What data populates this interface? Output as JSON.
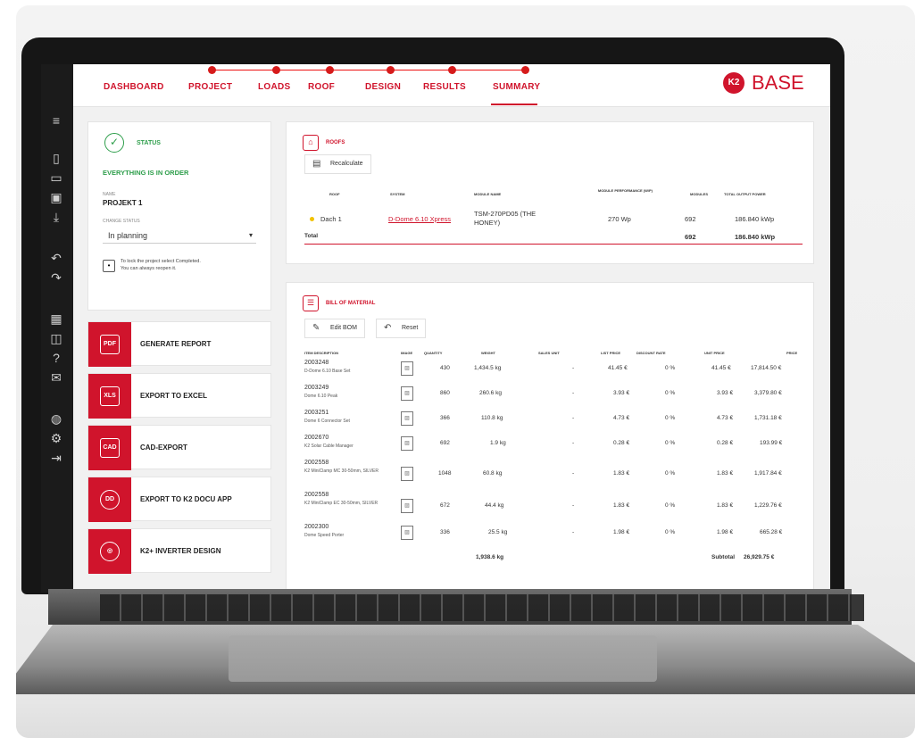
{
  "rail": {
    "icons": [
      "menu-icon",
      "new-project-icon",
      "folder-icon",
      "save-icon",
      "download-icon",
      "undo-icon",
      "redo-icon",
      "calculator-icon",
      "3d-view-icon",
      "help-icon",
      "chat-icon",
      "language-icon",
      "settings-icon",
      "logout-icon"
    ]
  },
  "nav": {
    "items": [
      "DASHBOARD",
      "PROJECT",
      "LOADS",
      "ROOF",
      "DESIGN",
      "RESULTS",
      "SUMMARY"
    ],
    "active": "SUMMARY",
    "logo_text": "BASE",
    "logo_mark": "K2"
  },
  "status": {
    "label": "STATUS",
    "message": "EVERYTHING IS IN ORDER",
    "name_label": "NAME",
    "project_name": "PROJEKT 1",
    "change_label": "CHANGE STATUS",
    "current_status": "In planning",
    "lock_hint_1": "To lock the project select Completed.",
    "lock_hint_2": "You can always reopen it."
  },
  "actions": [
    {
      "icon": "PDF",
      "label": "GENERATE REPORT"
    },
    {
      "icon": "XLS",
      "label": "EXPORT TO EXCEL"
    },
    {
      "icon": "CAD",
      "label": "CAD-EXPORT"
    },
    {
      "icon": "DD",
      "label": "EXPORT TO K2 DOCU APP"
    },
    {
      "icon": "◎",
      "label": "K2+ INVERTER DESIGN"
    }
  ],
  "roofs": {
    "title": "ROOFS",
    "recalculate": "Recalculate",
    "headers": [
      "ROOF",
      "SYSTEM",
      "MODULE NAME",
      "MODULE PERFORMANCE (W/P)",
      "MODULES",
      "TOTAL OUTPUT POWER"
    ],
    "row": {
      "roof": "Dach 1",
      "system": "D-Dome 6.10 Xpress",
      "module": "TSM-270PD05 (THE HONEY)",
      "performance": "270 Wp",
      "modules": "692",
      "output": "186.840 kWp"
    },
    "total_label": "Total",
    "total_modules": "692",
    "total_output": "186.840 kWp"
  },
  "bom": {
    "title": "BILL OF MATERIAL",
    "edit_button": "Edit BOM",
    "reset_button": "Reset",
    "headers": [
      "ITEM DESCRIPTION",
      "IMAGE",
      "QUANTITY",
      "WEIGHT",
      "SALES UNIT",
      "LIST PRICE",
      "DISCOUNT RATE",
      "UNIT PRICE",
      "PRICE"
    ],
    "rows": [
      {
        "code": "2003248",
        "desc": "D-Dome 6.10 Base Set",
        "qty": "430",
        "weight": "1,434.5 kg",
        "unit": "-",
        "list": "41.45 €",
        "disc": "0 %",
        "unitprice": "41.45 €",
        "price": "17,814.50 €"
      },
      {
        "code": "2003249",
        "desc": "Dome 6.10 Peak",
        "qty": "860",
        "weight": "260.6 kg",
        "unit": "-",
        "list": "3.93 €",
        "disc": "0 %",
        "unitprice": "3.93 €",
        "price": "3,379.80 €"
      },
      {
        "code": "2003251",
        "desc": "Dome 6 Connector Set",
        "qty": "366",
        "weight": "110.8 kg",
        "unit": "-",
        "list": "4.73 €",
        "disc": "0 %",
        "unitprice": "4.73 €",
        "price": "1,731.18 €"
      },
      {
        "code": "2002670",
        "desc": "K2 Solar Cable Manager",
        "qty": "692",
        "weight": "1.9 kg",
        "unit": "-",
        "list": "0.28 €",
        "disc": "0 %",
        "unitprice": "0.28 €",
        "price": "193.99 €"
      },
      {
        "code": "2002558",
        "desc": "K2 MiniClamp MC 30-50mm, SILVER",
        "qty": "1048",
        "weight": "60.8 kg",
        "unit": "-",
        "list": "1.83 €",
        "disc": "0 %",
        "unitprice": "1.83 €",
        "price": "1,917.84 €"
      },
      {
        "code": "2002558",
        "desc": "K2 MiniClamp EC 30-50mm, SILVER",
        "qty": "672",
        "weight": "44.4 kg",
        "unit": "-",
        "list": "1.83 €",
        "disc": "0 %",
        "unitprice": "1.83 €",
        "price": "1,229.76 €"
      },
      {
        "code": "2002300",
        "desc": "Dome Speed Porter",
        "qty": "336",
        "weight": "25.5 kg",
        "unit": "-",
        "list": "1.98 €",
        "disc": "0 %",
        "unitprice": "1.98 €",
        "price": "665.28 €"
      }
    ],
    "total_weight": "1,938.6 kg",
    "subtotal_label": "Subtotal",
    "subtotal": "26,929.75 €"
  }
}
